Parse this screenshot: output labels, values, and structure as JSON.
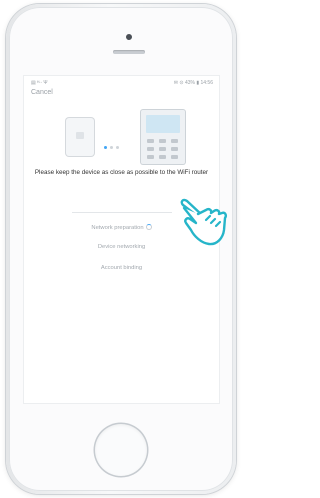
{
  "status_bar": {
    "left": "▤ ᴴ⸱⸱ Ψ",
    "right": "✉ ⊙ 43% ▮ 14:56"
  },
  "nav": {
    "cancel_label": "Cancel"
  },
  "instruction": "Please keep the device as close as possible to the WiFi router",
  "steps": [
    {
      "label": "Network preparation"
    },
    {
      "label": "Device networking"
    },
    {
      "label": "Account binding"
    }
  ],
  "pager": {
    "current_dot": 1,
    "dot_count": 3
  },
  "colors": {
    "accent": "#42a5f5",
    "muted_text": "#a3a9af",
    "hand_outline": "#26b5c9"
  }
}
